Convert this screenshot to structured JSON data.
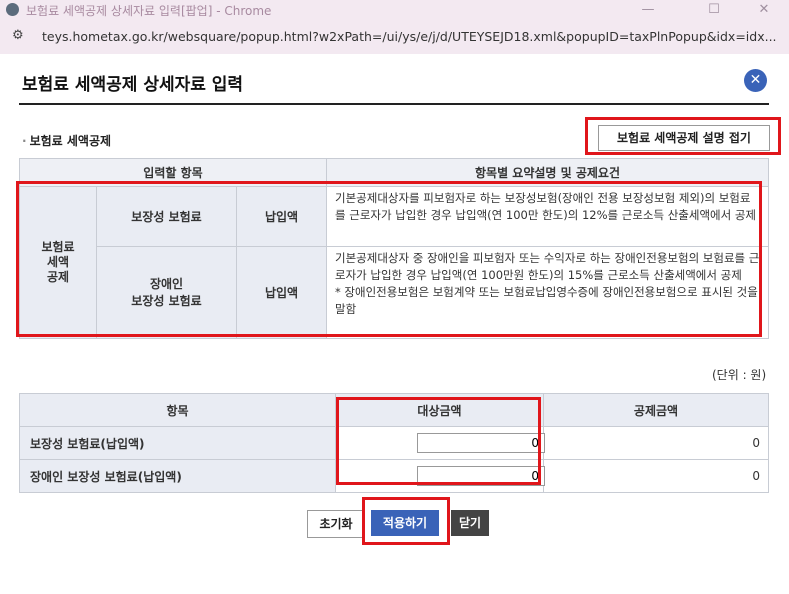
{
  "window": {
    "title": "보험료 세액공제 상세자료 입력[팝업] - Chrome",
    "url": "teys.hometax.go.kr/websquare/popup.html?w2xPath=/ui/ys/e/j/d/UTEYSEJD18.xml&popupID=taxPlnPopup&idx=idx..."
  },
  "popup": {
    "title": "보험료 세액공제 상세자료 입력",
    "section_label": "보험료 세액공제",
    "fold_button": "보험료 세액공제 설명 접기"
  },
  "info_table": {
    "headers": [
      "입력할 항목",
      "항목별 요약설명 및 공제요건"
    ],
    "category": "보험료\n세액\n공제",
    "rows": [
      {
        "item": "보장성 보험료",
        "type": "납입액",
        "desc": "기본공제대상자를 피보험자로 하는 보장성보험(장애인 전용 보장성보험 제외)의 보험료를 근로자가 납입한 경우 납입액(연 100만 한도)의 12%를 근로소득 산출세액에서 공제"
      },
      {
        "item": "장애인\n보장성 보험료",
        "type": "납입액",
        "desc": "기본공제대상자 중 장애인을 피보험자 또는 수익자로 하는 장애인전용보험의 보험료를 근로자가 납입한 경우 납입액(연 100만원 한도)의 15%를 근로소득 산출세액에서 공제",
        "note": "* 장애인전용보험은 보험계약 또는 보험료납입영수증에 장애인전용보험으로 표시된 것을 말함"
      }
    ]
  },
  "unit": "(단위 : 원)",
  "amount_table": {
    "headers": [
      "항목",
      "대상금액",
      "공제금액"
    ],
    "rows": [
      {
        "label": "보장성 보험료(납입액)",
        "target": "0",
        "deduction": "0"
      },
      {
        "label": "장애인 보장성 보험료(납입액)",
        "target": "0",
        "deduction": "0"
      }
    ]
  },
  "buttons": {
    "reset": "초기화",
    "apply": "적용하기",
    "close": "닫기"
  },
  "colors": {
    "highlight": "#e0161b",
    "primary": "#3a63b8",
    "dark": "#444444"
  }
}
